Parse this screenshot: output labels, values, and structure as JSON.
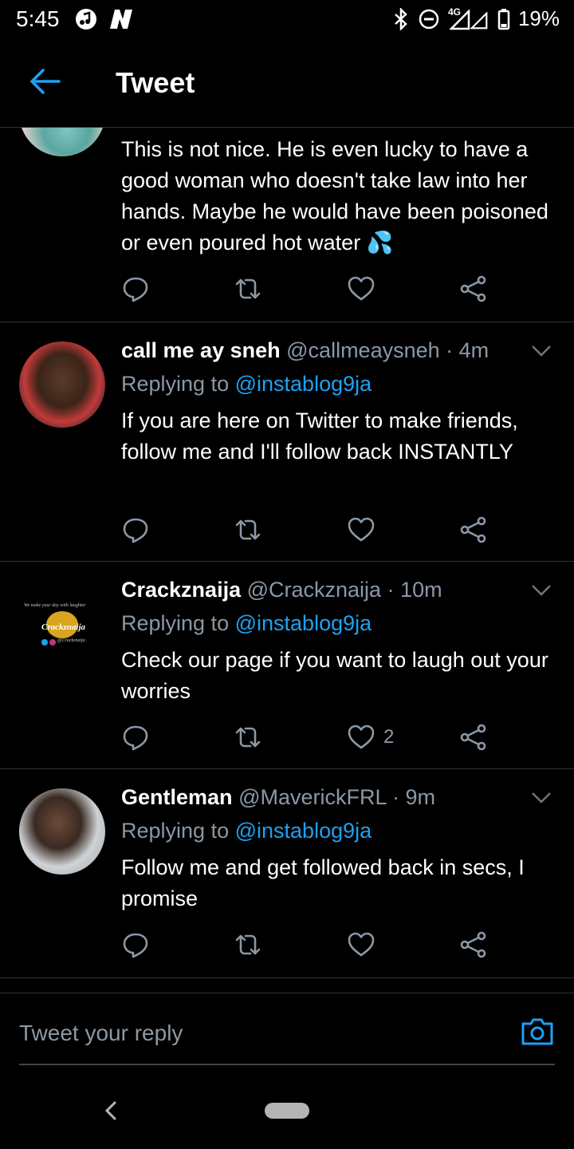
{
  "status_bar": {
    "time": "5:45",
    "network": "4G",
    "battery": "19%"
  },
  "header": {
    "title": "Tweet"
  },
  "tweets": [
    {
      "text": "This is not nice. He is even lucky to have a good woman who doesn't take law into her hands. Maybe he would have been poisoned or even poured hot water 💦",
      "likes": ""
    },
    {
      "name": "call me ay sneh",
      "handle": "@callmeaysneh · 4m",
      "replying_label": "Replying to",
      "replying_to": "@instablog9ja",
      "text": "If you are here on Twitter to make friends, follow me and I'll follow back INSTANTLY",
      "likes": ""
    },
    {
      "name": "Crackznaija",
      "handle": "@Crackznaija · 10m",
      "replying_label": "Replying to",
      "replying_to": "@instablog9ja",
      "text": "Check our page if you want to laugh out your worries",
      "likes": "2",
      "avatar_texts": {
        "tagline": "We make your day with laughter",
        "brand": "Crackznaija",
        "handle": "@Crackznaija"
      }
    },
    {
      "name": "Gentleman",
      "handle": "@MaverickFRL · 9m",
      "replying_label": "Replying to",
      "replying_to": "@instablog9ja",
      "text": "Follow me and get followed back in secs, I promise",
      "likes": ""
    }
  ],
  "reply_bar": {
    "placeholder": "Tweet your reply"
  },
  "icons": {
    "back": "arrow-left-icon",
    "reply": "reply-icon",
    "retweet": "retweet-icon",
    "like": "heart-icon",
    "share": "share-icon",
    "caret": "chevron-down-icon",
    "camera": "camera-icon"
  },
  "colors": {
    "accent": "#1da1f2",
    "background": "#000000",
    "secondary_text": "#8b98a5",
    "divider": "#2f3336"
  }
}
